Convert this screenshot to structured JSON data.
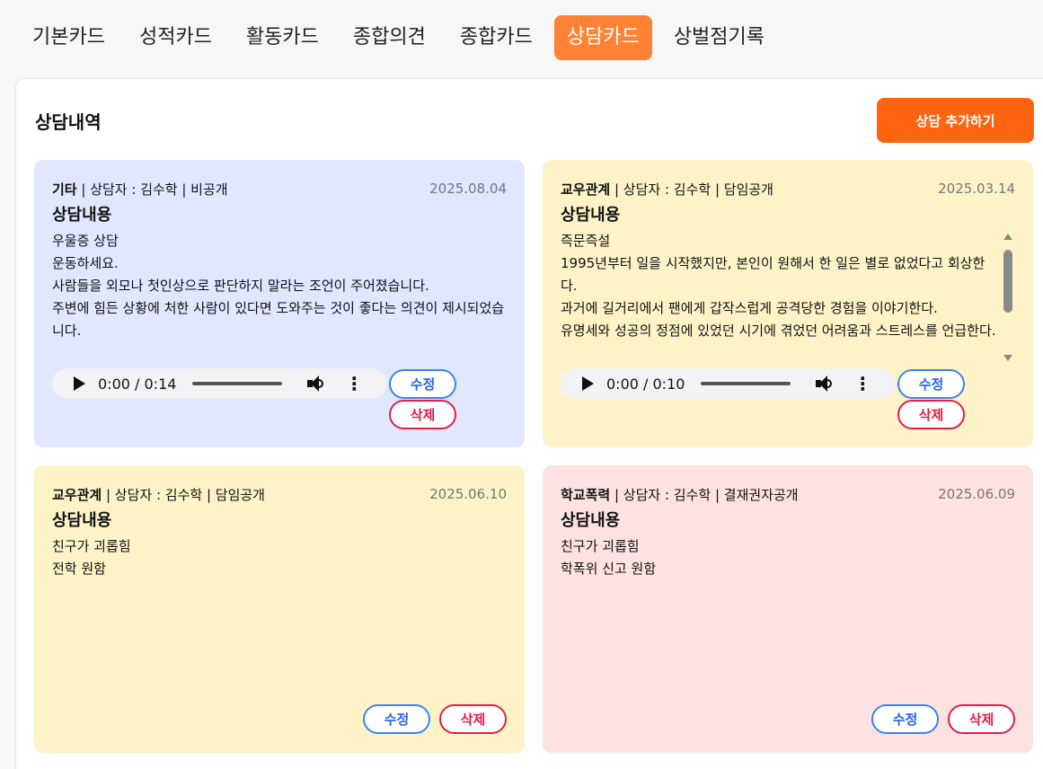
{
  "tabs": [
    {
      "label": "기본카드"
    },
    {
      "label": "성적카드"
    },
    {
      "label": "활동카드"
    },
    {
      "label": "종합의견"
    },
    {
      "label": "종합카드"
    },
    {
      "label": "상담카드"
    },
    {
      "label": "상벌점기록"
    }
  ],
  "active_tab": "상담카드",
  "panel": {
    "title": "상담내역",
    "add_button": "상담 추가하기"
  },
  "cards": [
    {
      "category": "기타",
      "meta": " | 상담자 : 김수학 | 비공개",
      "date": "2025.08.04",
      "title": "상담내용",
      "content": "우울증 상담\n운동하세요.\n사람들을 외모나 첫인상으로 판단하지 말라는 조언이 주어졌습니다.\n주변에 힘든 상황에 처한 사람이 있다면 도와주는 것이 좋다는 의견이 제시되었습니다.",
      "audio_time": "0:00 / 0:14",
      "edit": "수정",
      "delete": "삭제"
    },
    {
      "category": "교우관계",
      "meta": " | 상담자 : 김수학 | 담임공개",
      "date": "2025.03.14",
      "title": "상담내용",
      "content": "즉문즉설\n1995년부터 일을 시작했지만, 본인이 원해서 한 일은 별로 없었다고 회상한다.\n과거에 길거리에서 팬에게 갑작스럽게 공격당한 경험을 이야기한다.\n유명세와 성공의 정점에 있었던 시기에 겪었던 어려움과 스트레스를 언급한다.",
      "audio_time": "0:00 / 0:10",
      "edit": "수정",
      "delete": "삭제"
    },
    {
      "category": "교우관계",
      "meta": " | 상담자 : 김수학 | 담임공개",
      "date": "2025.06.10",
      "title": "상담내용",
      "content": "친구가 괴롭힘\n전학 원함",
      "edit": "수정",
      "delete": "삭제"
    },
    {
      "category": "학교폭력",
      "meta": " | 상담자 : 김수학 | 결재권자공개",
      "date": "2025.06.09",
      "title": "상담내용",
      "content": "친구가 괴롭힘\n학폭위 신고 원함",
      "edit": "수정",
      "delete": "삭제"
    }
  ]
}
